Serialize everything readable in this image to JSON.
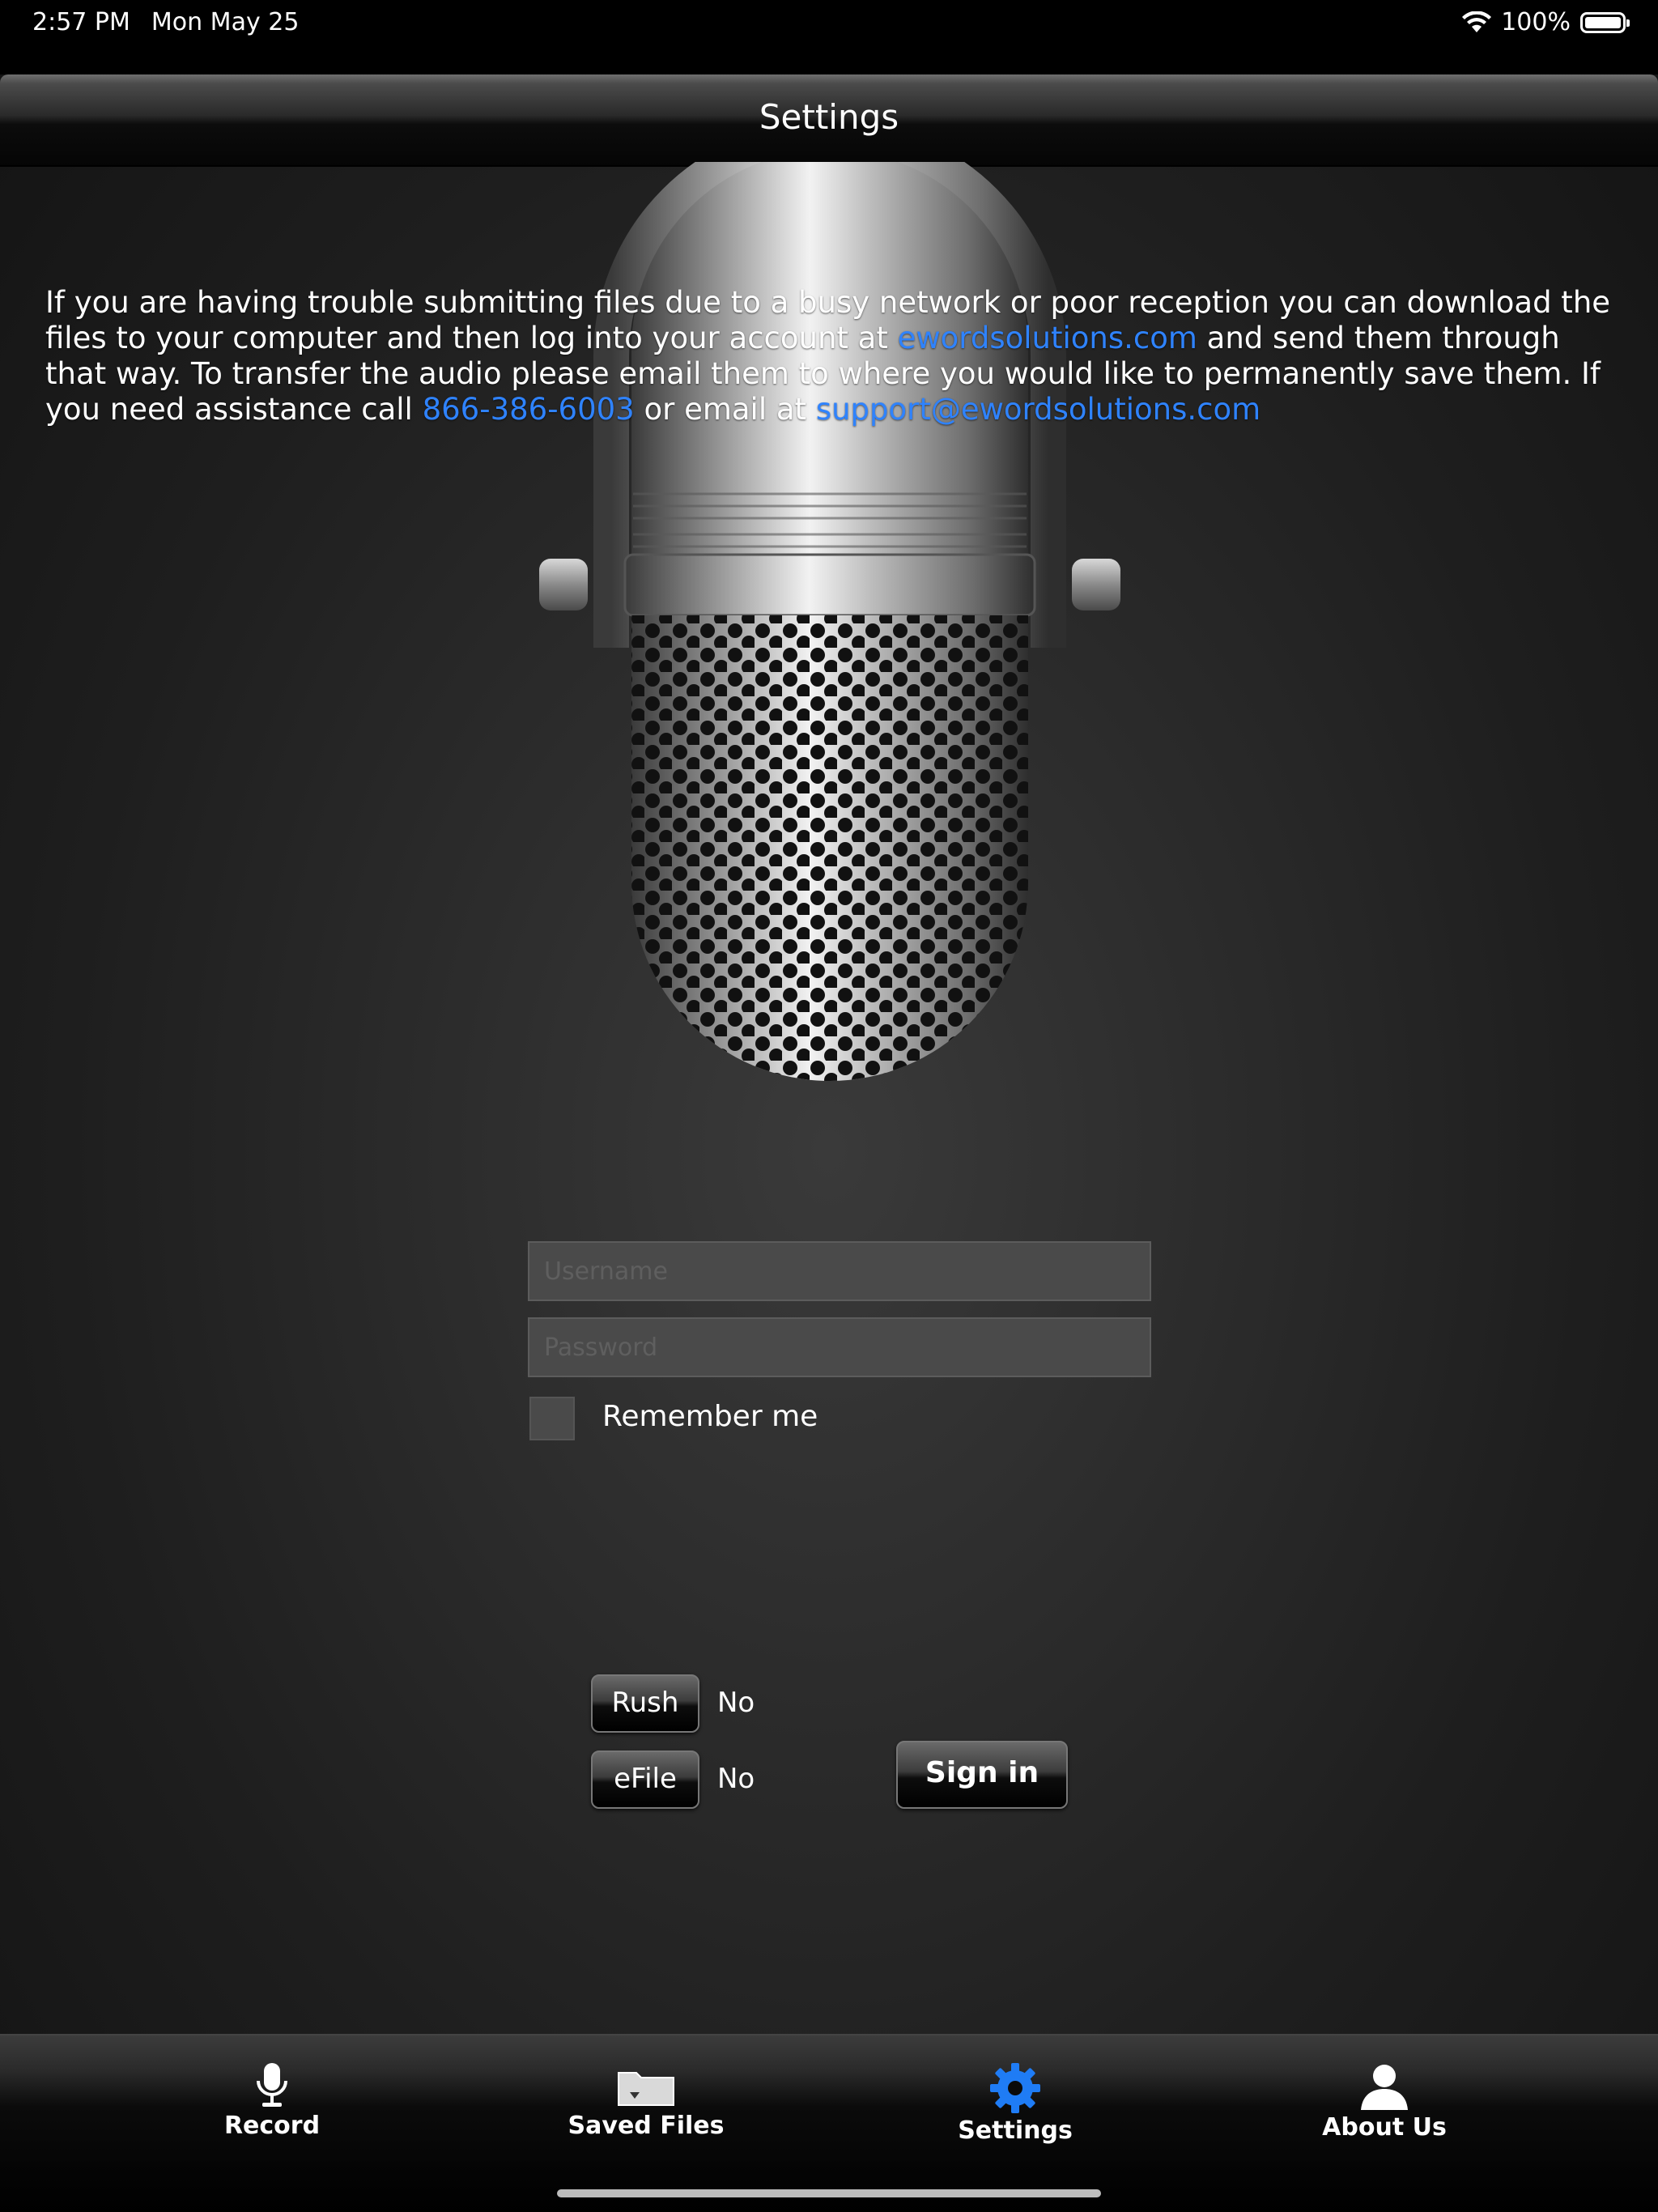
{
  "status_bar": {
    "time": "2:57 PM",
    "date": "Mon May 25",
    "battery": "100%",
    "icons": [
      "wifi-icon",
      "battery-icon"
    ]
  },
  "nav": {
    "title": "Settings"
  },
  "info": {
    "text_1": "If you are having trouble submitting files due to a busy network or poor reception you can download the files to your computer and then log into your account at ",
    "link_site": "ewordsolutions.com",
    "text_2": " and send them through that way. To transfer the audio please email them to where you would like to permanently save them. If you need assistance call ",
    "link_phone": "866-386-6003",
    "text_3": " or email at ",
    "link_email": "support@ewordsolutions.com"
  },
  "form": {
    "username_placeholder": "Username",
    "password_placeholder": "Password",
    "remember_label": "Remember me",
    "rush_label": "Rush",
    "rush_value": "No",
    "efile_label": "eFile",
    "efile_value": "No",
    "signin_label": "Sign in"
  },
  "tabs": [
    {
      "label": "Record",
      "icon": "microphone-icon",
      "active": false
    },
    {
      "label": "Saved Files",
      "icon": "folder-icon",
      "active": false
    },
    {
      "label": "Settings",
      "icon": "gear-icon",
      "active": true
    },
    {
      "label": "About Us",
      "icon": "person-icon",
      "active": false
    }
  ],
  "colors": {
    "link": "#2f83ff",
    "active_tab_icon": "#1f7cf5"
  }
}
